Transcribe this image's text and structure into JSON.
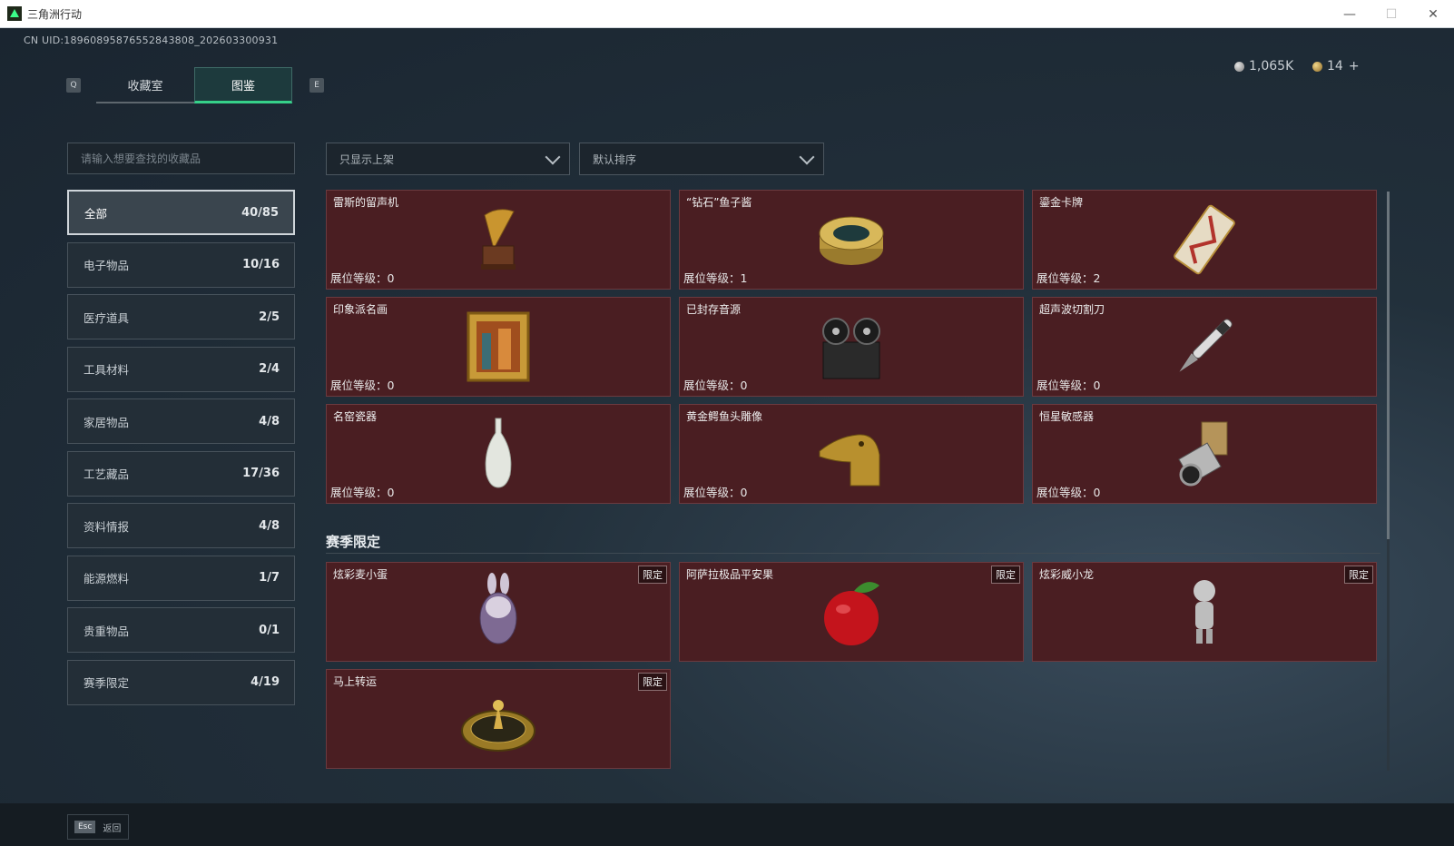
{
  "window": {
    "title": "三角洲行动",
    "min": "—",
    "max": "☐",
    "close": "✕"
  },
  "uid": "CN UID:18960895876552843808_202603300931",
  "keys": {
    "left": "Q",
    "right": "E",
    "esc": "Esc"
  },
  "tabs": [
    {
      "label": "收藏室"
    },
    {
      "label": "图鉴"
    }
  ],
  "currency": {
    "silver": "1,065K",
    "gold": "14",
    "add": "+"
  },
  "search": {
    "placeholder": "请输入想要查找的收藏品"
  },
  "filters": {
    "shelf": "只显示上架",
    "sort": "默认排序"
  },
  "categories": [
    {
      "label": "全部",
      "count": "40/85"
    },
    {
      "label": "电子物品",
      "count": "10/16"
    },
    {
      "label": "医疗道具",
      "count": "2/5"
    },
    {
      "label": "工具材料",
      "count": "2/4"
    },
    {
      "label": "家居物品",
      "count": "4/8"
    },
    {
      "label": "工艺藏品",
      "count": "17/36"
    },
    {
      "label": "资料情报",
      "count": "4/8"
    },
    {
      "label": "能源燃料",
      "count": "1/7"
    },
    {
      "label": "贵重物品",
      "count": "0/1"
    },
    {
      "label": "赛季限定",
      "count": "4/19"
    }
  ],
  "items": [
    {
      "name": "雷斯的留声机",
      "level": "展位等级：0",
      "icon": "gramophone-icon"
    },
    {
      "name": "“钻石”鱼子酱",
      "level": "展位等级：1",
      "icon": "caviar-icon"
    },
    {
      "name": "鎏金卡牌",
      "level": "展位等级：2",
      "icon": "card-icon"
    },
    {
      "name": "印象派名画",
      "level": "展位等级：0",
      "icon": "painting-icon"
    },
    {
      "name": "已封存音源",
      "level": "展位等级：0",
      "icon": "tape-recorder-icon"
    },
    {
      "name": "超声波切割刀",
      "level": "展位等级：0",
      "icon": "knife-icon"
    },
    {
      "name": "名窑瓷器",
      "level": "展位等级：0",
      "icon": "vase-icon"
    },
    {
      "name": "黄金鳄鱼头雕像",
      "level": "展位等级：0",
      "icon": "croc-statue-icon"
    },
    {
      "name": "恒星敏感器",
      "level": "展位等级：0",
      "icon": "sensor-icon"
    }
  ],
  "season": {
    "title": "赛季限定",
    "items": [
      {
        "name": "炫彩麦小蛋",
        "tag": "限定",
        "icon": "rabbit-egg-icon"
      },
      {
        "name": "阿萨拉极品平安果",
        "tag": "限定",
        "icon": "apple-icon"
      },
      {
        "name": "炫彩威小龙",
        "tag": "限定",
        "icon": "dragon-figure-icon"
      },
      {
        "name": "马上转运",
        "tag": "限定",
        "icon": "spinner-icon"
      }
    ]
  },
  "footer": {
    "back": "返回"
  }
}
